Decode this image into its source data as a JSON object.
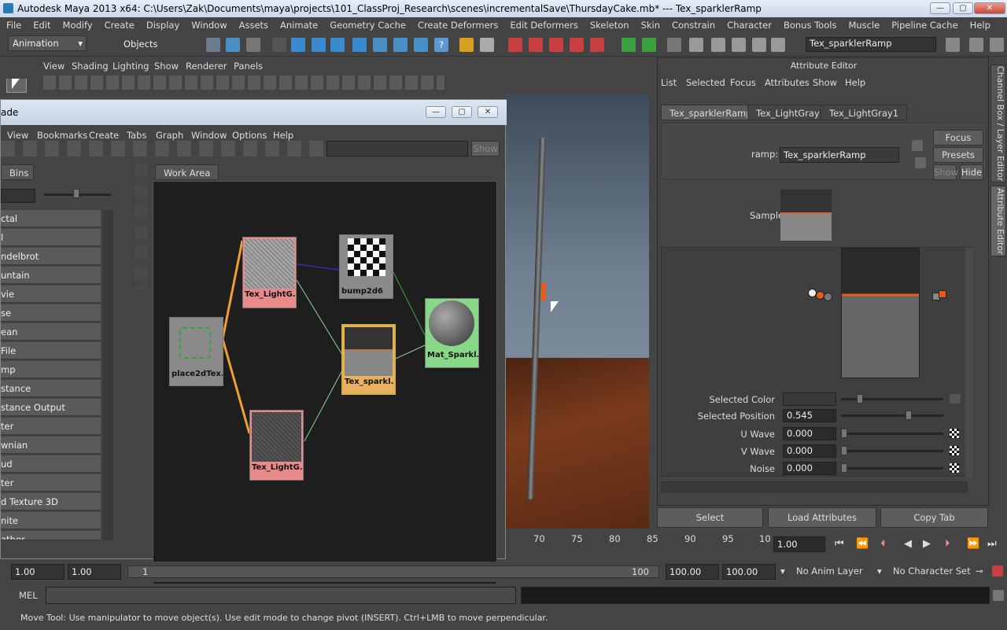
{
  "window": {
    "title": "Autodesk Maya 2013 x64: C:\\Users\\Zak\\Documents\\maya\\projects\\101_ClassProj_Research\\scenes\\incrementalSave\\ThursdayCake.mb*   ---   Tex_sparklerRamp",
    "min": "—",
    "max": "▢",
    "close": "✕"
  },
  "menubar": [
    "File",
    "Edit",
    "Modify",
    "Create",
    "Display",
    "Window",
    "Assets",
    "Animate",
    "Geometry Cache",
    "Create Deformers",
    "Edit Deformers",
    "Skeleton",
    "Skin",
    "Constrain",
    "Character",
    "Bonus Tools",
    "Muscle",
    "Pipeline Cache",
    "Help"
  ],
  "shelf": {
    "mode": "Animation",
    "objects": "Objects",
    "name_field": "Tex_sparklerRamp"
  },
  "viewport_menu": [
    "View",
    "Shading",
    "Lighting",
    "Show",
    "Renderer",
    "Panels"
  ],
  "hypershade": {
    "title": "ade",
    "menu": [
      "View",
      "Bookmarks",
      "Create",
      "Tabs",
      "Graph",
      "Window",
      "Options",
      "Help"
    ],
    "show": "Show",
    "bins": "Bins",
    "workarea": "Work Area",
    "list": [
      "ctal",
      "l",
      "ndelbrot",
      "untain",
      "vie",
      "se",
      "ean",
      "File",
      "mp",
      "stance",
      "stance Output",
      "ter",
      "wnian",
      "ud",
      "ter",
      "d Texture 3D",
      "nite",
      "ather"
    ],
    "nodes": {
      "lightgray_top": "Tex_LightG...",
      "bump": "bump2d6",
      "place": "place2dTex...",
      "sparkler": "Tex_sparkl...",
      "mat": "Mat_Sparkl...",
      "lightgray_bottom": "Tex_LightG..."
    }
  },
  "attribute_editor": {
    "header": "Attribute Editor",
    "menu": [
      "List",
      "Selected",
      "Focus",
      "Attributes",
      "Show",
      "Help"
    ],
    "tabs": [
      "Tex_sparklerRamp",
      "Tex_LightGray",
      "Tex_LightGray1"
    ],
    "ramp_label": "ramp:",
    "ramp_value": "Tex_sparklerRamp",
    "focus": "Focus",
    "presets": "Presets",
    "show": "Show",
    "hide": "Hide",
    "sample": "Sample",
    "selected_color": "Selected Color",
    "selected_position_label": "Selected Position",
    "selected_position": "0.545",
    "u_wave_label": "U Wave",
    "u_wave": "0.000",
    "v_wave_label": "V Wave",
    "v_wave": "0.000",
    "noise_label": "Noise",
    "noise": "0.000",
    "select": "Select",
    "load": "Load Attributes",
    "copy": "Copy Tab"
  },
  "side_tabs": [
    "Channel Box / Layer Editor",
    "Attribute Editor"
  ],
  "timeline": {
    "ticks": [
      "70",
      "75",
      "80",
      "85",
      "90",
      "95",
      "10"
    ],
    "current": "1.00"
  },
  "range": {
    "start": "1.00",
    "start2": "1.00",
    "slider_start": "1",
    "slider_end": "100",
    "end": "100.00",
    "end2": "100.00",
    "anim_layer": "No Anim Layer",
    "char_set": "No Character Set"
  },
  "cmd": {
    "label": "MEL"
  },
  "help": "Move Tool: Use manipulator to move object(s). Use edit mode to change pivot (INSERT).  Ctrl+LMB to move perpendicular.",
  "colors": {
    "accent": "#e85a1a",
    "node_pink": "#e88a8a",
    "node_green": "#88d888",
    "node_yellow": "#d8b040"
  }
}
